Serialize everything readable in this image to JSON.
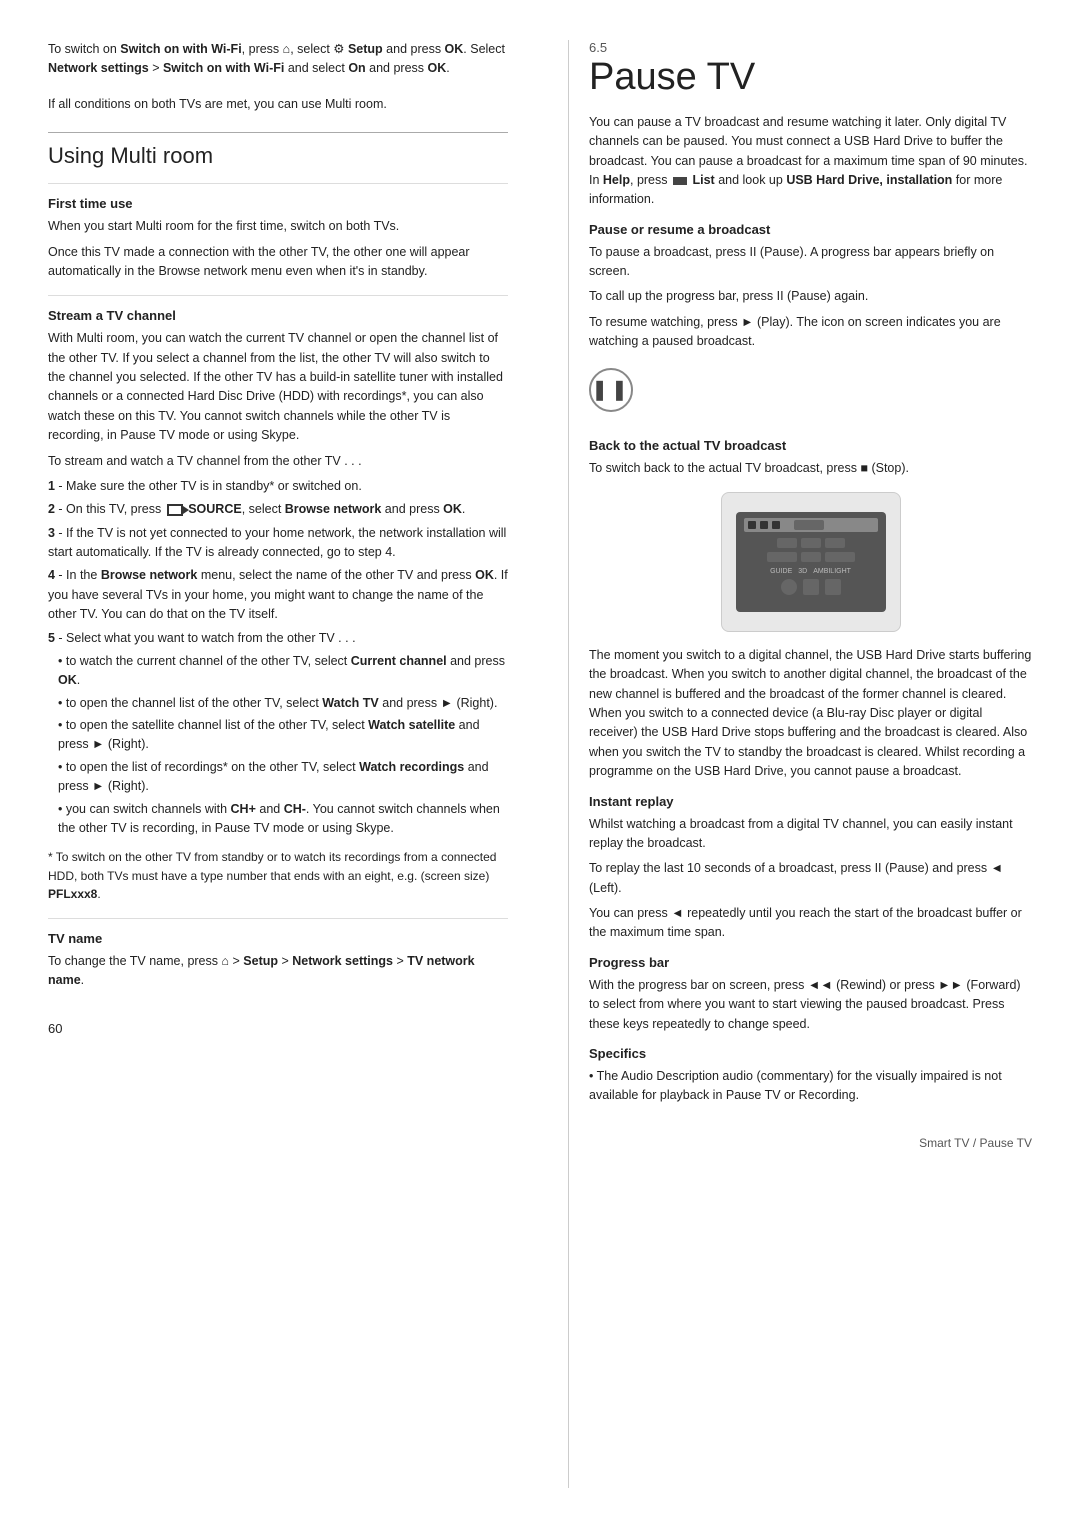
{
  "page": {
    "number": "60",
    "footer_right": "Smart TV / Pause TV"
  },
  "left": {
    "intro": {
      "line1": "To switch on Switch on with Wi-Fi, press",
      "line2": "Setup and press OK. Select Network settings > Switch on",
      "line3": "with Wi-Fi and select On and press OK.",
      "para2": "If all conditions on both TVs are met, you can use Multi room."
    },
    "section_title": "Using Multi room",
    "first_time": {
      "heading": "First time use",
      "para1": "When you start Multi room for the first time, switch on both TVs.",
      "para2": "Once this TV made a connection with the other TV, the other one will appear automatically in the Browse network menu even when it's in standby."
    },
    "stream": {
      "heading": "Stream a TV channel",
      "para1": "With Multi room, you can watch the current TV channel or open the channel list of the other TV. If you select a channel from the list, the other TV will also switch to the channel you selected. If the other TV has a build-in satellite tuner with installed channels or a connected Hard Disc Drive (HDD) with recordings*, you can also watch these on this TV. You cannot switch channels while the other TV is recording, in Pause TV mode or using Skype.",
      "para2": "To stream and watch a TV channel from the other TV . . .",
      "steps": [
        {
          "num": "1",
          "text": "- Make sure the other TV is in standby* or switched on."
        },
        {
          "num": "2",
          "text": "- On this TV, press  SOURCE, select Browse network and press OK."
        },
        {
          "num": "3",
          "text": "- If the TV is not yet connected to your home network, the network installation will start automatically. If the TV is already connected, go to step 4."
        },
        {
          "num": "4",
          "text": "- In the Browse network menu, select the name of the other TV and press OK. If you have several TVs in your home, you might want to change the name of the other TV. You can do that on the TV itself."
        },
        {
          "num": "5",
          "text": "- Select what you want to watch from the other TV . . ."
        }
      ],
      "bullets": [
        "to watch the current channel of the other TV, select Current channel and press OK.",
        "to open the channel list of the other TV, select Watch TV and press ► (Right).",
        "to open the satellite channel list of the other TV, select Watch satellite and press ► (Right).",
        "to open the list of recordings* on the other TV, select Watch recordings and press ► (Right).",
        "you can switch channels with CH+ and CH-. You cannot switch channels when the other TV is recording, in Pause TV mode or using Skype."
      ],
      "footnote": "* To switch on the other TV from standby or to watch its recordings from a connected HDD, both TVs must have a type number that ends with an eight, e.g. (screen size) PFLxxx8."
    },
    "tv_name": {
      "heading": "TV name",
      "text": "To change the TV name, press  > Setup > Network settings > TV network name."
    }
  },
  "right": {
    "chapter": "6.5",
    "title": "Pause TV",
    "intro": "You can pause a TV broadcast and resume watching it later. Only digital TV channels can be paused. You must connect a USB Hard Drive to buffer the broadcast. You can pause a broadcast for a maximum time span of 90 minutes. In Help, press  List and look up USB Hard Drive, installation for more information.",
    "pause_resume": {
      "heading": "Pause or resume a broadcast",
      "para1": "To pause a broadcast, press II (Pause). A progress bar appears briefly on screen.",
      "para2": "To call up the progress bar, press II (Pause) again.",
      "para3": "To resume watching, press ► (Play). The icon on screen indicates you are watching a paused broadcast."
    },
    "back_broadcast": {
      "heading": "Back to the actual TV broadcast",
      "text": "To switch back to the actual TV broadcast, press ■ (Stop)."
    },
    "buffering_text": "The moment you switch to a digital channel, the USB Hard Drive starts buffering the broadcast. When you switch to another digital channel, the broadcast of the new channel is buffered and the broadcast of the former channel is cleared. When you switch to a connected device (a Blu-ray Disc player or digital receiver) the USB Hard Drive stops buffering and the broadcast is cleared. Also when you switch the TV to standby the broadcast is cleared. Whilst recording a programme on the USB Hard Drive, you cannot pause a broadcast.",
    "instant_replay": {
      "heading": "Instant replay",
      "para1": "Whilst watching a broadcast from a digital TV channel, you can easily instant replay the broadcast.",
      "para2": "To replay the last 10 seconds of a broadcast, press II (Pause) and press ◄ (Left).",
      "para3": "You can press ◄ repeatedly until you reach the start of the broadcast buffer or the maximum time span."
    },
    "progress_bar": {
      "heading": "Progress bar",
      "text": "With the progress bar on screen, press ◄◄ (Rewind) or press ►► (Forward) to select from where you want to start viewing the paused broadcast. Press these keys repeatedly to change speed."
    },
    "specifics": {
      "heading": "Specifics",
      "text": "• The Audio Description audio (commentary) for the visually impaired is not available for playback in Pause TV or Recording."
    }
  }
}
